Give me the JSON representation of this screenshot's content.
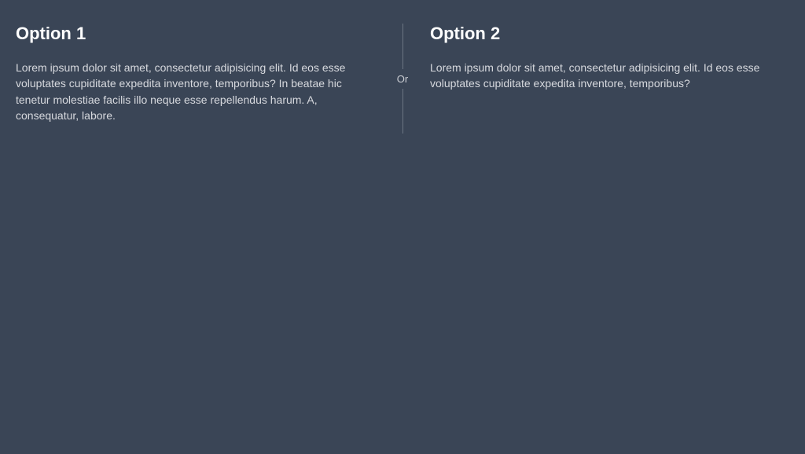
{
  "left": {
    "title": "Option 1",
    "body": "Lorem ipsum dolor sit amet, consectetur adipisicing elit. Id eos esse voluptates cupiditate expedita inventore, temporibus? In beatae hic tenetur molestiae facilis illo neque esse repellendus harum. A, consequatur, labore."
  },
  "divider": {
    "label": "Or"
  },
  "right": {
    "title": "Option 2",
    "body": "Lorem ipsum dolor sit amet, consectetur adipisicing elit. Id eos esse voluptates cupiditate expedita inventore, temporibus?"
  }
}
